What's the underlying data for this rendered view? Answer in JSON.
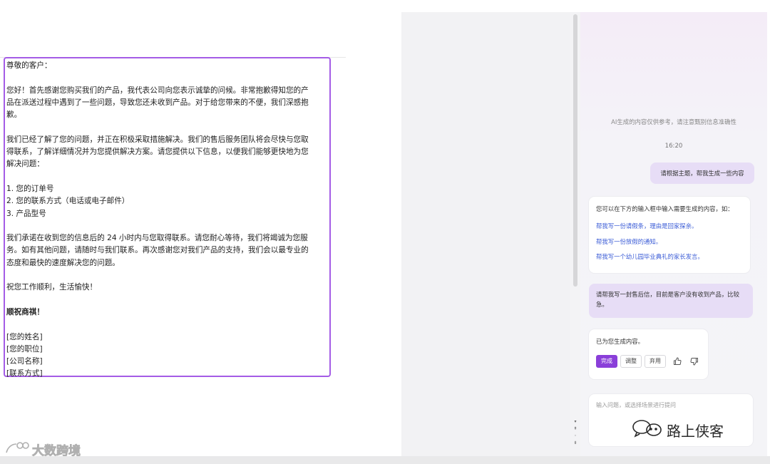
{
  "document": {
    "lines": [
      "尊敬的客户：",
      "",
      "您好！首先感谢您购买我们的产品，我代表公司向您表示诚挚的问候。非常抱歉得知您的产",
      "品在派送过程中遇到了一些问题，导致您还未收到产品。对于给您带来的不便，我们深感抱",
      "歉。",
      "",
      "我们已经了解了您的问题，并正在积极采取措施解决。我们的售后服务团队将会尽快与您取",
      "得联系，了解详细情况并为您提供解决方案。请您提供以下信息，以便我们能够更快地为您",
      "解决问题：",
      "",
      "1. 您的订单号",
      "2. 您的联系方式（电话或电子邮件）",
      "3. 产品型号",
      "",
      "我们承诺在收到您的信息后的 24 小时内与您取得联系。请您耐心等待，我们将竭诚为您服",
      "务。如有其他问题，请随时与我们联系。再次感谢您对我们产品的支持，我们会以最专业的",
      "态度和最快的速度解决您的问题。",
      "",
      "祝您工作顺利，生活愉快！",
      "",
      "顺祝商祺！",
      "",
      "[您的姓名]",
      "[您的职位]",
      "[公司名称]",
      "[联系方式]"
    ]
  },
  "ai_panel": {
    "disclaimer": "AI生成的内容仅供参考，请注意甄别信息准确性",
    "time": "16:20",
    "user_message_1": "请根据主题，帮我生成一些内容",
    "intro": {
      "head": "您可以在下方的输入框中输入需要生成的内容，如：",
      "links": [
        "帮我写一份请假条，理由是回家探亲。",
        "帮我写一份放假的通知。",
        "帮我写一个幼儿园毕业典礼的家长发言。"
      ]
    },
    "user_message_2": "请帮我写一封售后信，目前是客户没有收到产品，比较急。",
    "result": {
      "message": "已为您生成内容。",
      "done_label": "完成",
      "adjust_label": "调整",
      "discard_label": "弃用"
    },
    "input_placeholder": "输入问题，或选择场景进行提问"
  },
  "watermarks": {
    "right": "路上侠客",
    "left": "大数跨境"
  },
  "colors": {
    "accent": "#8a3fd9",
    "link": "#3a5bd6",
    "user_bubble": "#e7ddf6",
    "selection_border": "#a45ce6"
  }
}
